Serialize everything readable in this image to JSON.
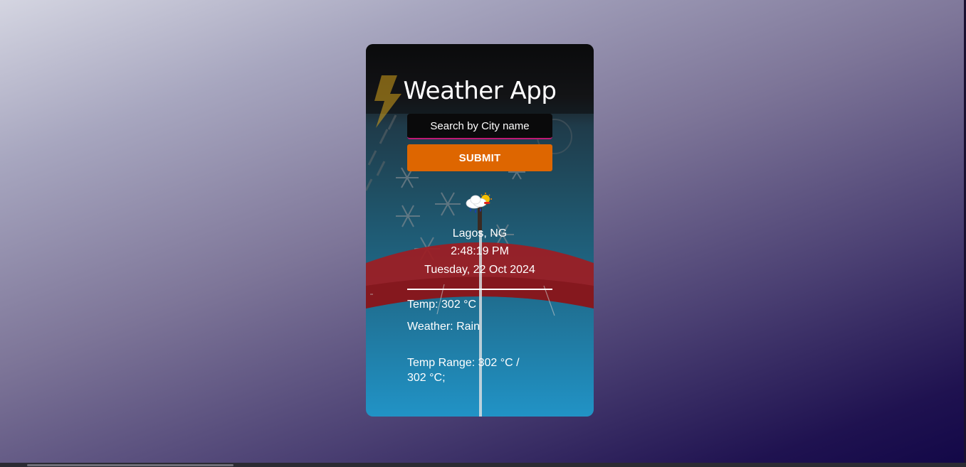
{
  "app": {
    "title": "Weather App"
  },
  "search": {
    "placeholder": "Search by City name",
    "value": ""
  },
  "submit": {
    "label": "SUBMIT"
  },
  "weather": {
    "icon": "rain-cloud-sun-icon",
    "location": "Lagos, NG",
    "time": "2:48:19 PM",
    "date": "Tuesday, 22 Oct 2024",
    "temp_line": "Temp: 302 °C",
    "weather_line": "Weather: Rain",
    "range_line": "Temp Range: 302 °C / 302 °C;"
  },
  "colors": {
    "accent": "#de6600",
    "input_border": "#c01a73",
    "background_top": "#d4d5e1",
    "background_bottom": "#120747"
  }
}
